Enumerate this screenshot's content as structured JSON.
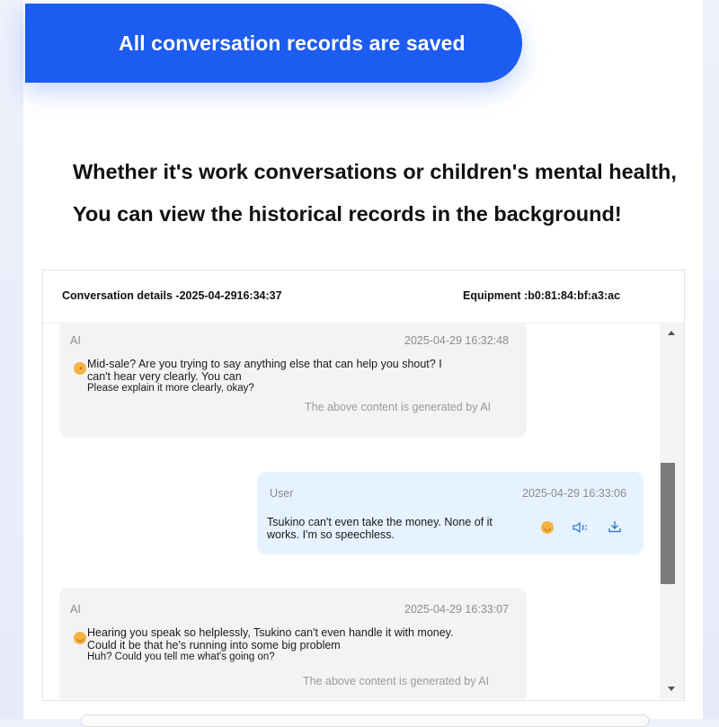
{
  "banner": {
    "text": "All conversation records are saved"
  },
  "headline": {
    "line1": "Whether it's work conversations or children's mental health,",
    "line2": "You can view the historical records in the background!"
  },
  "panel": {
    "title": "Conversation details -2025-04-2916:34:37",
    "equipment": "Equipment :b0:81:84:bf:a3:ac"
  },
  "messages": [
    {
      "role": "AI",
      "time": "2025-04-29 16:32:48",
      "lines": [
        "Mid-sale? Are you trying to say anything else that can help you shout? I",
        "can't hear very clearly. You can",
        "Please explain it more clearly, okay?"
      ],
      "note": "The above content is generated by AI",
      "emoji": "surprised-face-icon"
    },
    {
      "role": "User",
      "time": "2025-04-29 16:33:06",
      "lines": [
        "Tsukino can't even take the money. None of it",
        "works. I'm so speechless."
      ],
      "emoji": "sad-face-icon"
    },
    {
      "role": "AI",
      "time": "2025-04-29 16:33:07",
      "lines": [
        "Hearing you speak so helplessly, Tsukino can't even handle it with money.",
        "Could it be that he's running into some big problem",
        "Huh? Could you tell me what's going on?"
      ],
      "note": "The above content is generated by AI",
      "emoji": "sad-face-icon"
    }
  ],
  "colors": {
    "accent": "#1d5cf0",
    "user_bubble": "#e6f2ff",
    "ai_bubble": "#f3f3f5",
    "icon_blue": "#2f7bd6"
  }
}
